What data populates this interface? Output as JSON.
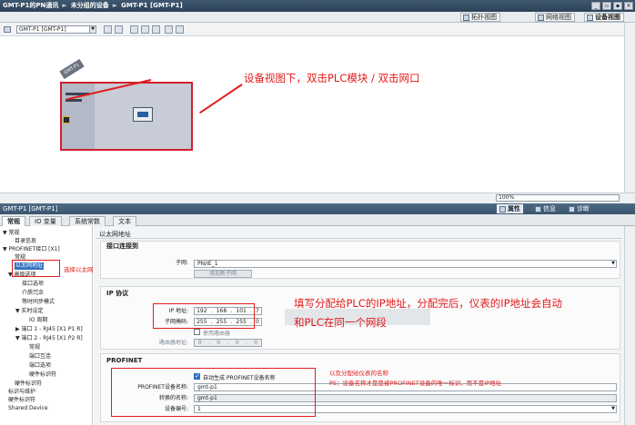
{
  "title_bar": {
    "crumbs": [
      "GMT-P1的PN通讯",
      "未分组的设备",
      "GMT-P1 [GMT-P1]"
    ],
    "sep": "►",
    "buttons": [
      "_",
      "▫",
      "▪",
      "✕"
    ]
  },
  "view_tabs": [
    {
      "label": "拓扑视图",
      "active": false
    },
    {
      "label": "网络视图",
      "active": false
    },
    {
      "label": "设备视图",
      "active": true
    }
  ],
  "toolbar": {
    "device_select": "GMT-P1 [GMT-P1]",
    "zoom": "100%"
  },
  "device": {
    "label": "GMT-P1"
  },
  "annotations": {
    "a1": "设备视图下，双击PLC模块 / 双击网口",
    "a2": "选择以太网地址",
    "a3": "填写分配给PLC的IP地址，分配完后，仪表的IP地址会自动和PLC在同一个网段",
    "a4": "以及分配给仪表的名称",
    "a5": "PS：设备名称才是是被PROFINET设备的唯一标识，而不是IP地址"
  },
  "inspector": {
    "title": "GMT-P1 [GMT-P1]",
    "buttons": [
      {
        "label": "属性",
        "active": true
      },
      {
        "label": "信息",
        "active": false
      },
      {
        "label": "诊断",
        "active": false
      }
    ],
    "tabs": [
      {
        "label": "常规",
        "active": true
      },
      {
        "label": "IO 变量",
        "active": false
      },
      {
        "label": "系统常数",
        "active": false
      },
      {
        "label": "文本",
        "active": false
      }
    ]
  },
  "tree": [
    "▼ 常规",
    "目录信息",
    "▼ PROFINET接口 [X1]",
    "常规",
    "以太网地址",
    "▼ 高级选项",
    "接口选项",
    "介质冗余",
    "等时同步模式",
    "▼ 实时设定",
    "IO 周期",
    "▶ 端口 1 - RJ45 [X1 P1 R]",
    "▼ 端口 2 - RJ45 [X1 P2 R]",
    "常规",
    "端口互连",
    "端口选项",
    "硬件标识符",
    "硬件标识符",
    "标识与维护",
    "硬件标识符",
    "Shared Device"
  ],
  "form": {
    "page_title": "以太网地址",
    "sec_iface": "接口连接到",
    "subnet_label": "子网:",
    "subnet_value": "PN/IE_1",
    "add_subnet": "添加新子网",
    "sec_ip": "IP 协议",
    "ip_label": "IP 地址:",
    "ip": [
      "192",
      "168",
      "101",
      "7"
    ],
    "mask_label": "子网掩码:",
    "mask": [
      "255",
      "255",
      "255",
      "0"
    ],
    "router_check": "使用路由器",
    "router_label": "路由器地址:",
    "router": [
      "0",
      "0",
      "0",
      "0"
    ],
    "sec_pn": "PROFINET",
    "auto_name": "自动生成 PROFINET设备名称",
    "devname_label": "PROFINET设备名称:",
    "devname": "gmt-p1",
    "convname_label": "转换的名称:",
    "convname": "gmt-p1",
    "devnum_label": "设备编号:",
    "devnum": "1"
  }
}
